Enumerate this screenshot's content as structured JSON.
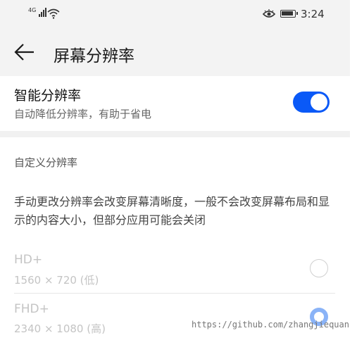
{
  "status_bar": {
    "network": "4G",
    "time": "3:24",
    "icons": [
      "signal-icon",
      "wifi-icon",
      "eye-comfort-icon",
      "battery-icon"
    ]
  },
  "header": {
    "back_icon": "arrow-left-icon",
    "title": "屏幕分辨率"
  },
  "smart_resolution": {
    "title": "智能分辨率",
    "subtitle": "自动降低分辨率，有助于省电",
    "enabled": true,
    "toggle_color": "#0a59f7"
  },
  "custom": {
    "section_label": "自定义分辨率",
    "description": "手动更改分辨率会改变屏幕清晰度，一般不会改变屏幕布局和显示的内容大小，但部分应用可能会关闭",
    "options": [
      {
        "name": "HD+",
        "resolution": "1560 × 720 (低)",
        "selected": false
      },
      {
        "name": "FHD+",
        "resolution": "2340 × 1080 (高)",
        "selected": true
      }
    ]
  },
  "watermark": "https://github.com/zhangjiequan"
}
